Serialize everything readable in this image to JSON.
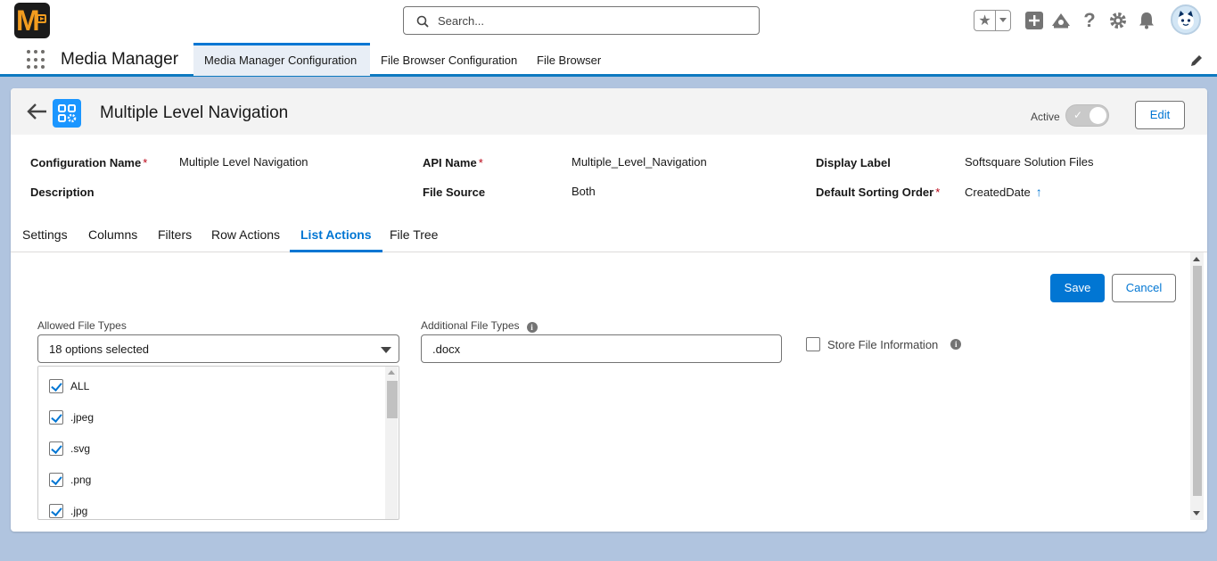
{
  "header": {
    "logo_text": "M",
    "search_placeholder": "Search...",
    "icons": [
      "star-icon",
      "chevron-down-icon",
      "plus-icon",
      "trailhead-icon",
      "help-icon",
      "gear-icon",
      "bell-icon",
      "avatar-icon"
    ]
  },
  "nav": {
    "app_name": "Media Manager",
    "tabs": [
      {
        "label": "Media Manager Configuration",
        "active": true
      },
      {
        "label": "File Browser Configuration",
        "active": false
      },
      {
        "label": "File Browser",
        "active": false
      }
    ]
  },
  "record": {
    "title": "Multiple Level Navigation",
    "active_label": "Active",
    "active": true,
    "edit_label": "Edit"
  },
  "fields": {
    "configuration_name_label": "Configuration Name",
    "configuration_name_value": "Multiple Level Navigation",
    "api_name_label": "API Name",
    "api_name_value": "Multiple_Level_Navigation",
    "display_label_label": "Display Label",
    "display_label_value": "Softsquare Solution Files",
    "description_label": "Description",
    "description_value": "",
    "file_source_label": "File Source",
    "file_source_value": "Both",
    "sorting_label": "Default Sorting Order",
    "sorting_value": "CreatedDate",
    "required_mark": "*"
  },
  "tabs": [
    {
      "label": "Settings",
      "active": false
    },
    {
      "label": "Columns",
      "active": false
    },
    {
      "label": "Filters",
      "active": false
    },
    {
      "label": "Row Actions",
      "active": false
    },
    {
      "label": "List Actions",
      "active": true
    },
    {
      "label": "File Tree",
      "active": false
    }
  ],
  "actions": {
    "save_label": "Save",
    "cancel_label": "Cancel"
  },
  "form": {
    "allowed_label": "Allowed File Types",
    "allowed_value": "18 options selected",
    "additional_label": "Additional File Types",
    "additional_value": ".docx",
    "store_label": "Store File Information",
    "store_checked": false,
    "info_glyph": "i",
    "options": [
      {
        "label": "ALL",
        "checked": true
      },
      {
        "label": ".jpeg",
        "checked": true
      },
      {
        "label": ".svg",
        "checked": true
      },
      {
        "label": ".png",
        "checked": true
      },
      {
        "label": ".jpg",
        "checked": true
      }
    ]
  },
  "colors": {
    "brand": "#0176d3",
    "required": "#ba0517",
    "background": "#b0c4df"
  }
}
